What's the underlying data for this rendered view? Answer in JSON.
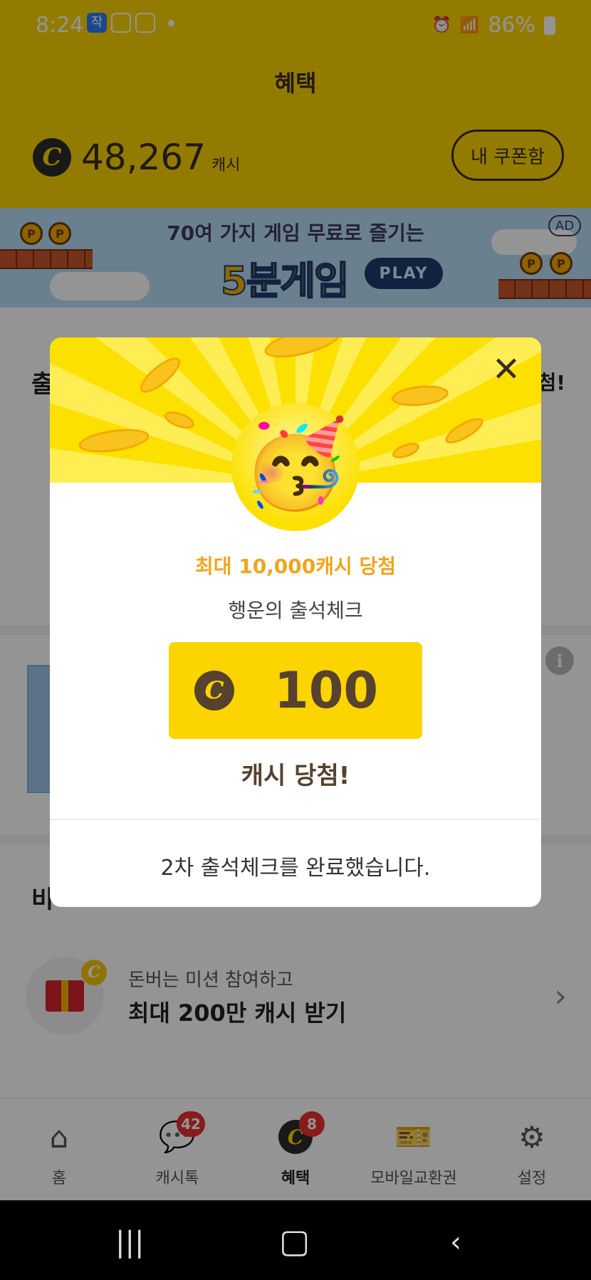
{
  "status_bar": {
    "time": "8:24",
    "notif_app_label": "작",
    "battery": "86%"
  },
  "header": {
    "title": "혜택",
    "cash_amount": "48,267",
    "cash_unit": "캐시",
    "coupon_button": "내 쿠폰함"
  },
  "ad_banner": {
    "line1": "70여 가지 게임 무료로 즐기는",
    "line2": "5분게임",
    "play": "PLAY",
    "badge": "AD"
  },
  "page": {
    "section_title": "출",
    "section_right": "첨!",
    "section2_title": "비",
    "mission": {
      "subtitle": "돈버는 미션 참여하고",
      "title": "최대 200만 캐시 받기"
    }
  },
  "bottom_nav": {
    "items": [
      {
        "label": "홈"
      },
      {
        "label": "캐시톡",
        "badge": "42"
      },
      {
        "label": "혜택",
        "badge": "8"
      },
      {
        "label": "모바일교환권"
      },
      {
        "label": "설정"
      }
    ]
  },
  "modal": {
    "promo": "최대 10,000캐시 당첨",
    "subtitle": "행운의 출석체크",
    "prize_value": "100",
    "won_text": "캐시 당첨!",
    "completion": "2차 출석체크를 완료했습니다.",
    "emoji": "🥳"
  },
  "colors": {
    "brand_yellow": "#fbd400",
    "promo_orange": "#f0a51b",
    "text_brown": "#56422e",
    "badge_red": "#e8312f"
  }
}
